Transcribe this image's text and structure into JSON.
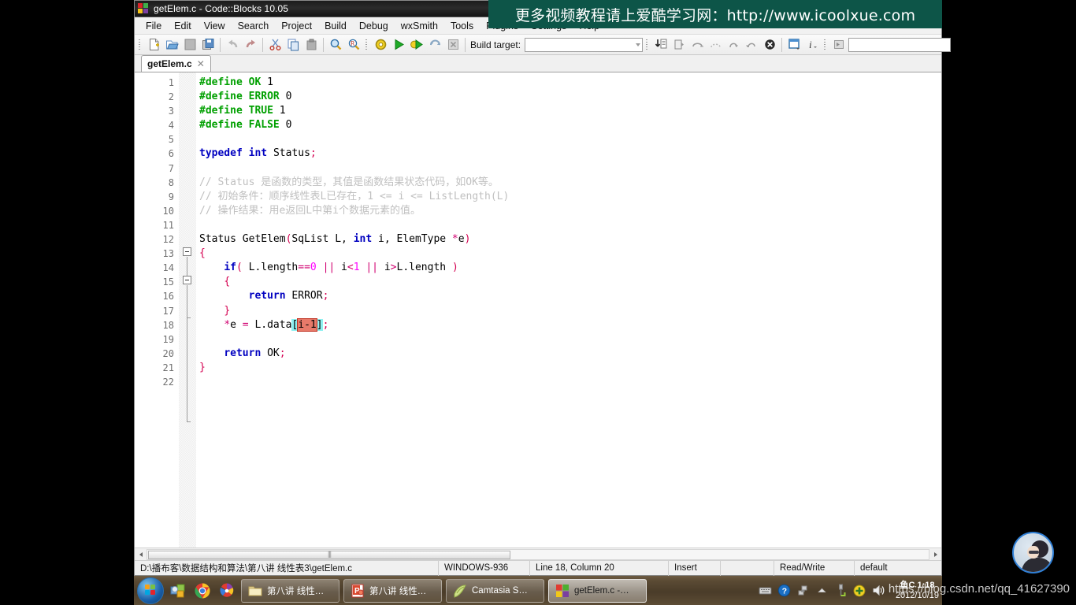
{
  "window": {
    "title": "getElem.c - Code::Blocks 10.05",
    "logo_icon": "codeblocks-logo-icon"
  },
  "banner": {
    "text": "更多视频教程请上爱酷学习网：http://www.icoolxue.com",
    "bg": "#0d5548"
  },
  "menubar": {
    "items": [
      {
        "label": "File"
      },
      {
        "label": "Edit"
      },
      {
        "label": "View"
      },
      {
        "label": "Search"
      },
      {
        "label": "Project"
      },
      {
        "label": "Build"
      },
      {
        "label": "Debug"
      },
      {
        "label": "wxSmith"
      },
      {
        "label": "Tools"
      },
      {
        "label": "Plugins"
      },
      {
        "label": "Settings"
      },
      {
        "label": "Help"
      }
    ]
  },
  "toolbar": {
    "build_target_label": "Build target:",
    "build_target_value": "",
    "debug_expression_value": "",
    "icons": [
      "new-file-icon",
      "open-file-icon",
      "save-file-icon",
      "save-all-icon",
      "undo-icon",
      "redo-icon",
      "cut-icon",
      "copy-icon",
      "paste-icon",
      "find-icon",
      "replace-icon",
      "build-icon",
      "run-icon",
      "build-and-run-icon",
      "rebuild-icon",
      "abort-icon",
      "debug-continue-icon",
      "debug-run-to-cursor-icon",
      "debug-next-line-icon",
      "debug-step-into-icon",
      "debug-step-out-icon",
      "debug-next-instruction-icon",
      "debug-stop-icon",
      "debug-windows-icon",
      "debug-info-icon",
      "debug-evaluate-icon"
    ]
  },
  "tabs": [
    {
      "label": "getElem.c",
      "close_icon": "close-icon",
      "active": true
    }
  ],
  "editor": {
    "lines": [
      {
        "n": 1,
        "tokens": [
          {
            "t": "#define ",
            "c": "pp"
          },
          {
            "t": "OK ",
            "c": "pp"
          },
          {
            "t": "1",
            "c": "plain"
          }
        ]
      },
      {
        "n": 2,
        "tokens": [
          {
            "t": "#define ",
            "c": "pp"
          },
          {
            "t": "ERROR ",
            "c": "pp"
          },
          {
            "t": "0",
            "c": "plain"
          }
        ]
      },
      {
        "n": 3,
        "tokens": [
          {
            "t": "#define ",
            "c": "pp"
          },
          {
            "t": "TRUE ",
            "c": "pp"
          },
          {
            "t": "1",
            "c": "plain"
          }
        ]
      },
      {
        "n": 4,
        "tokens": [
          {
            "t": "#define ",
            "c": "pp"
          },
          {
            "t": "FALSE ",
            "c": "pp"
          },
          {
            "t": "0",
            "c": "plain"
          }
        ]
      },
      {
        "n": 5,
        "tokens": []
      },
      {
        "n": 6,
        "tokens": [
          {
            "t": "typedef ",
            "c": "kw"
          },
          {
            "t": "int ",
            "c": "kw"
          },
          {
            "t": "Status",
            "c": "plain"
          },
          {
            "t": ";",
            "c": "punct"
          }
        ]
      },
      {
        "n": 7,
        "tokens": []
      },
      {
        "n": 8,
        "tokens": [
          {
            "t": "// Status 是函数的类型，其值是函数结果状态代码，如OK等。",
            "c": "cm"
          }
        ]
      },
      {
        "n": 9,
        "tokens": [
          {
            "t": "// 初始条件：顺序线性表L已存在，1 <= i <= ListLength(L)",
            "c": "cm"
          }
        ]
      },
      {
        "n": 10,
        "tokens": [
          {
            "t": "// 操作结果：用e返回L中第i个数据元素的值。",
            "c": "cm"
          }
        ]
      },
      {
        "n": 11,
        "tokens": []
      },
      {
        "n": 12,
        "tokens": [
          {
            "t": "Status GetElem",
            "c": "plain"
          },
          {
            "t": "(",
            "c": "punct"
          },
          {
            "t": "SqList L, ",
            "c": "plain"
          },
          {
            "t": "int",
            "c": "kw"
          },
          {
            "t": " i, ElemType ",
            "c": "plain"
          },
          {
            "t": "*",
            "c": "op"
          },
          {
            "t": "e",
            "c": "plain"
          },
          {
            "t": ")",
            "c": "punct"
          }
        ]
      },
      {
        "n": 13,
        "tokens": [
          {
            "t": "{",
            "c": "punct"
          }
        ]
      },
      {
        "n": 14,
        "tokens": [
          {
            "t": "    ",
            "c": "plain"
          },
          {
            "t": "if",
            "c": "kw"
          },
          {
            "t": "(",
            "c": "punct"
          },
          {
            "t": " L.length",
            "c": "plain"
          },
          {
            "t": "==",
            "c": "op"
          },
          {
            "t": "0",
            "c": "num"
          },
          {
            "t": " ",
            "c": "plain"
          },
          {
            "t": "||",
            "c": "op"
          },
          {
            "t": " i",
            "c": "plain"
          },
          {
            "t": "<",
            "c": "op"
          },
          {
            "t": "1",
            "c": "num"
          },
          {
            "t": " ",
            "c": "plain"
          },
          {
            "t": "||",
            "c": "op"
          },
          {
            "t": " i",
            "c": "plain"
          },
          {
            "t": ">",
            "c": "op"
          },
          {
            "t": "L.length ",
            "c": "plain"
          },
          {
            "t": ")",
            "c": "punct"
          }
        ]
      },
      {
        "n": 15,
        "tokens": [
          {
            "t": "    ",
            "c": "plain"
          },
          {
            "t": "{",
            "c": "punct"
          }
        ]
      },
      {
        "n": 16,
        "tokens": [
          {
            "t": "        ",
            "c": "plain"
          },
          {
            "t": "return",
            "c": "kw"
          },
          {
            "t": " ERROR",
            "c": "plain"
          },
          {
            "t": ";",
            "c": "punct"
          }
        ]
      },
      {
        "n": 17,
        "tokens": [
          {
            "t": "    ",
            "c": "plain"
          },
          {
            "t": "}",
            "c": "punct"
          }
        ]
      },
      {
        "n": 18,
        "tokens": [
          {
            "t": "    ",
            "c": "plain"
          },
          {
            "t": "*",
            "c": "op"
          },
          {
            "t": "e ",
            "c": "plain"
          },
          {
            "t": "=",
            "c": "op"
          },
          {
            "t": " L.data",
            "c": "plain"
          },
          {
            "t": "[",
            "c": "bracehl"
          },
          {
            "t": "i-1",
            "c": "sel"
          },
          {
            "t": "]",
            "c": "bracehl"
          },
          {
            "t": ";",
            "c": "punct"
          }
        ]
      },
      {
        "n": 19,
        "tokens": []
      },
      {
        "n": 20,
        "tokens": [
          {
            "t": "    ",
            "c": "plain"
          },
          {
            "t": "return",
            "c": "kw"
          },
          {
            "t": " OK",
            "c": "plain"
          },
          {
            "t": ";",
            "c": "punct"
          }
        ]
      },
      {
        "n": 21,
        "tokens": [
          {
            "t": "}",
            "c": "punct"
          }
        ]
      },
      {
        "n": 22,
        "tokens": []
      }
    ],
    "selection_text": "i-1",
    "selection_color": "#e87a6a",
    "brace_match_color": "#8ff0f0"
  },
  "statusbar": {
    "file_path": "D:\\播布客\\数据结构和算法\\第八讲 线性表3\\getElem.c",
    "encoding": "WINDOWS-936",
    "caret": "Line 18, Column 20",
    "insert_mode": "Insert",
    "blank": "",
    "access_mode": "Read/Write",
    "profile": "default"
  },
  "taskbar": {
    "start_icon": "windows-start-icon",
    "quick_launch": [
      {
        "icon": "show-desktop-icon"
      },
      {
        "icon": "chrome-icon"
      },
      {
        "icon": "pinwheel-icon"
      }
    ],
    "tasks": [
      {
        "icon": "folder-icon",
        "label": "第八讲 线性…",
        "active": false
      },
      {
        "icon": "powerpoint-icon",
        "label": "第八讲 线性…",
        "active": false
      },
      {
        "icon": "camtasia-icon",
        "label": "Camtasia S…",
        "active": false
      },
      {
        "icon": "codeblocks-icon",
        "label": "getElem.c -…",
        "active": true
      }
    ],
    "tray": [
      {
        "icon": "keyboard-icon"
      },
      {
        "icon": "help-icon"
      },
      {
        "icon": "network-icon"
      },
      {
        "icon": "show-hidden-icons-icon"
      },
      {
        "icon": "usb-icon"
      },
      {
        "icon": "security-shield-icon"
      },
      {
        "icon": "volume-icon"
      }
    ],
    "clock_time": "鱼C 1:18",
    "clock_date": "2012/10/19"
  },
  "overlay": {
    "watermark": "https://blog.csdn.net/qq_41627390",
    "avatar_icon": "user-avatar-icon"
  }
}
